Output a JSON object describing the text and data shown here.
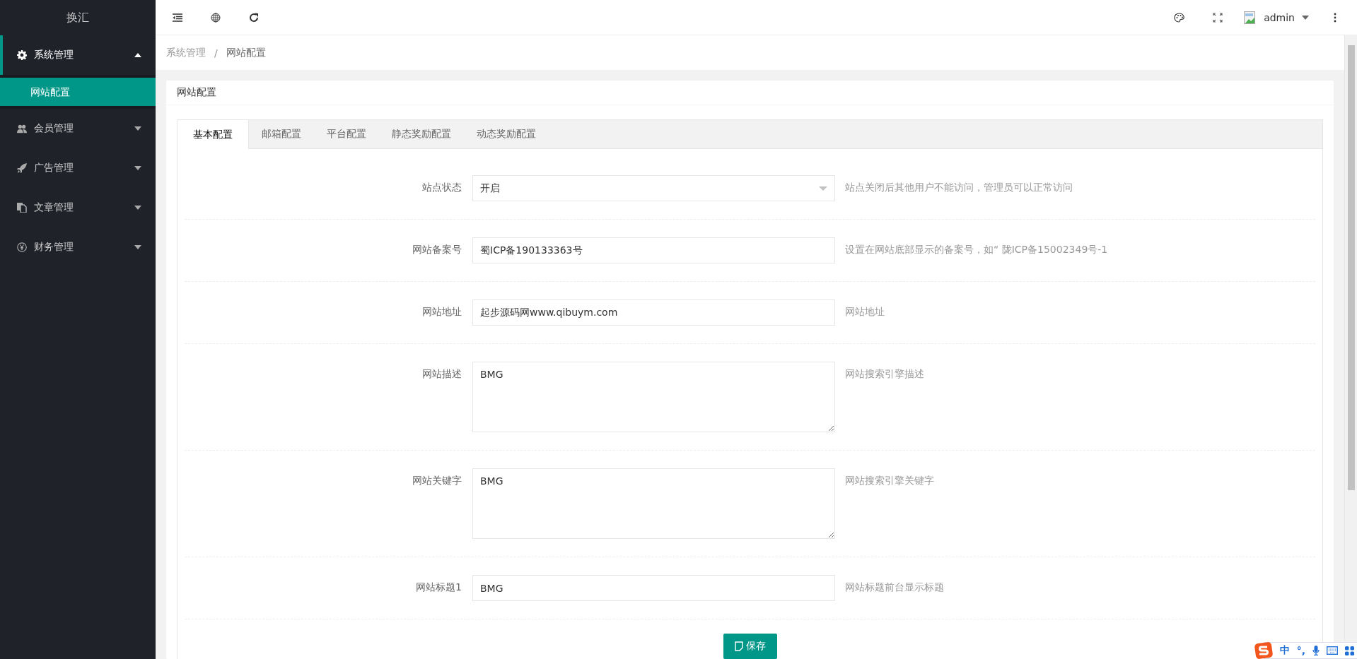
{
  "sidebar": {
    "logo": "换汇",
    "items": [
      {
        "label": "系统管理",
        "expanded": true,
        "children": [
          {
            "label": "网站配置",
            "selected": true
          }
        ]
      },
      {
        "label": "会员管理",
        "expanded": false
      },
      {
        "label": "广告管理",
        "expanded": false
      },
      {
        "label": "文章管理",
        "expanded": false
      },
      {
        "label": "财务管理",
        "expanded": false
      }
    ]
  },
  "topbar": {
    "user": "admin"
  },
  "breadcrumb": {
    "separator": "/",
    "items": [
      "系统管理",
      "网站配置"
    ]
  },
  "card": {
    "title": "网站配置",
    "tabs": [
      {
        "label": "基本配置",
        "selected": true
      },
      {
        "label": "邮箱配置",
        "selected": false
      },
      {
        "label": "平台配置",
        "selected": false
      },
      {
        "label": "静态奖励配置",
        "selected": false
      },
      {
        "label": "动态奖励配置",
        "selected": false
      }
    ],
    "fields": [
      {
        "kind": "select",
        "label": "站点状态",
        "value": "开启",
        "hint": "站点关闭后其他用户不能访问，管理员可以正常访问"
      },
      {
        "kind": "text",
        "label": "网站备案号",
        "value": "蜀ICP备190133363号",
        "hint": "设置在网站底部显示的备案号，如“ 陇ICP备15002349号-1"
      },
      {
        "kind": "text",
        "label": "网站地址",
        "value": "起步源码网www.qibuym.com",
        "hint": "网站地址"
      },
      {
        "kind": "textarea",
        "label": "网站描述",
        "value": "BMG",
        "hint": "网站搜索引擎描述"
      },
      {
        "kind": "textarea",
        "label": "网站关键字",
        "value": "BMG",
        "hint": "网站搜索引擎关键字"
      },
      {
        "kind": "text",
        "label": "网站标题1",
        "value": "BMG",
        "hint": "网站标题前台显示标题"
      }
    ],
    "save_button": "保存"
  },
  "ime": {
    "mode": "中",
    "punctuation": "°,"
  }
}
